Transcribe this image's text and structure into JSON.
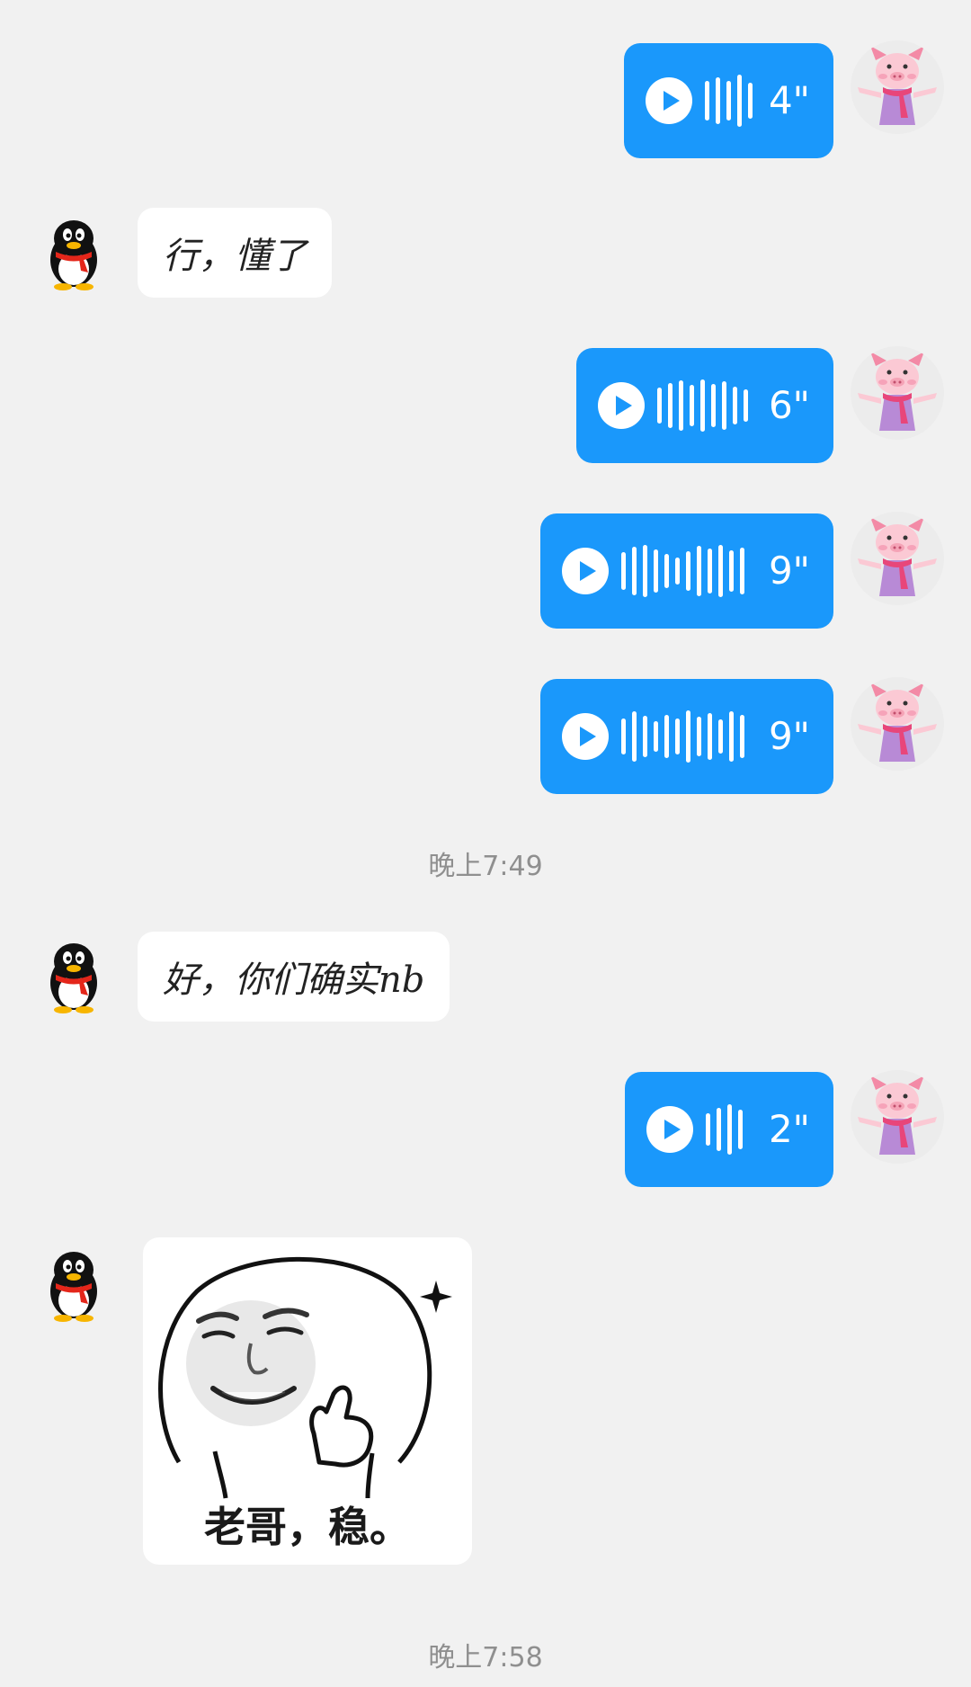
{
  "colors": {
    "background": "#f1f1f1",
    "voice_bubble": "#1a98fb",
    "text_bubble": "#ffffff",
    "timestamp": "#8f8f8f"
  },
  "messages": [
    {
      "side": "right",
      "type": "voice",
      "duration": "4\"",
      "icon": "play-icon"
    },
    {
      "side": "left",
      "type": "text",
      "text": "行，懂了"
    },
    {
      "side": "right",
      "type": "voice",
      "duration": "6\"",
      "icon": "play-icon"
    },
    {
      "side": "right",
      "type": "voice",
      "duration": "9\"",
      "icon": "play-icon"
    },
    {
      "side": "right",
      "type": "voice",
      "duration": "9\"",
      "icon": "play-icon"
    },
    {
      "type": "timestamp",
      "text": "晚上7:49"
    },
    {
      "side": "left",
      "type": "text",
      "text": "好，你们确实nb"
    },
    {
      "side": "right",
      "type": "voice",
      "duration": "2\"",
      "icon": "play-icon"
    },
    {
      "side": "left",
      "type": "sticker",
      "caption": "老哥，稳。"
    },
    {
      "type": "timestamp",
      "text": "晚上7:58"
    }
  ],
  "avatars": {
    "left": "qq-penguin-avatar",
    "right": "piglet-avatar"
  }
}
